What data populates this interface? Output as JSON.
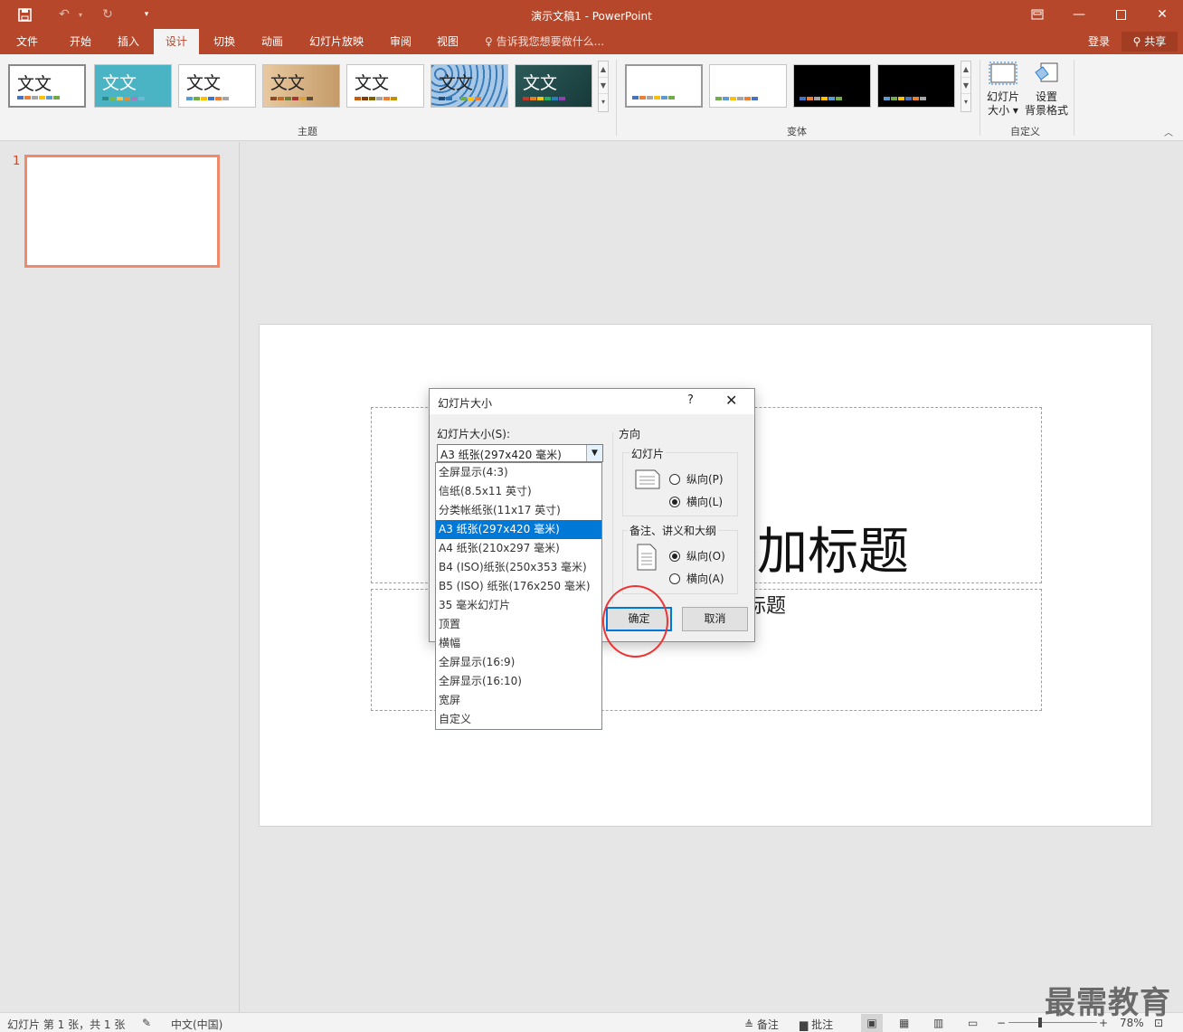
{
  "app": {
    "doc_title": "演示文稿1 - PowerPoint"
  },
  "qat": {
    "save_icon": "save-icon",
    "undo_icon": "undo-icon",
    "redo_icon": "redo-icon",
    "customize_icon": "customize-icon"
  },
  "window": {
    "restore_ribbon_icon": "ribbon-display-icon",
    "minimize_icon": "minimize-icon",
    "maximize_icon": "maximize-icon",
    "close_icon": "close-icon"
  },
  "tabs": [
    "文件",
    "开始",
    "插入",
    "设计",
    "切换",
    "动画",
    "幻灯片放映",
    "审阅",
    "视图"
  ],
  "active_tab": "设计",
  "tellme": "告诉我您想要做什么...",
  "account": {
    "login": "登录",
    "share": "共享"
  },
  "ribbon": {
    "theme_sample_text": "文文",
    "groups": {
      "themes": "主题",
      "variants": "变体",
      "customize": "自定义"
    },
    "slide_size_label_1": "幻灯片",
    "slide_size_label_2": "大小 ▾",
    "bg_format_label_1": "设置",
    "bg_format_label_2": "背景格式"
  },
  "thumbs": {
    "slide_number": "1"
  },
  "slide": {
    "title_text": "添加标题",
    "subtitle_text": "副标题"
  },
  "dialog": {
    "title": "幻灯片大小",
    "help": "?",
    "size_label": "幻灯片大小(S):",
    "size_value": "A3 纸张(297x420 毫米)",
    "orientation": "方向",
    "slides_group": "幻灯片",
    "slides_portrait": "纵向(P)",
    "slides_landscape": "横向(L)",
    "notes_group": "备注、讲义和大纲",
    "notes_portrait": "纵向(O)",
    "notes_landscape": "横向(A)",
    "ok": "确定",
    "cancel": "取消",
    "options": [
      "全屏显示(4:3)",
      "信纸(8.5x11 英寸)",
      "分类帐纸张(11x17 英寸)",
      "A3 纸张(297x420 毫米)",
      "A4 纸张(210x297 毫米)",
      "B4 (ISO)纸张(250x353 毫米)",
      "B5 (ISO) 纸张(176x250 毫米)",
      "35 毫米幻灯片",
      "顶置",
      "横幅",
      "全屏显示(16:9)",
      "全屏显示(16:10)",
      "宽屏",
      "自定义"
    ],
    "selected_index": 3
  },
  "status": {
    "slide_info": "幻灯片 第 1 张，共 1 张",
    "language": "中文(中国)",
    "notes": "备注",
    "comments": "批注",
    "zoom": "78%"
  },
  "watermark": "最需教育",
  "colors": {
    "accent": "#b7472a",
    "selection": "#0078d7"
  }
}
